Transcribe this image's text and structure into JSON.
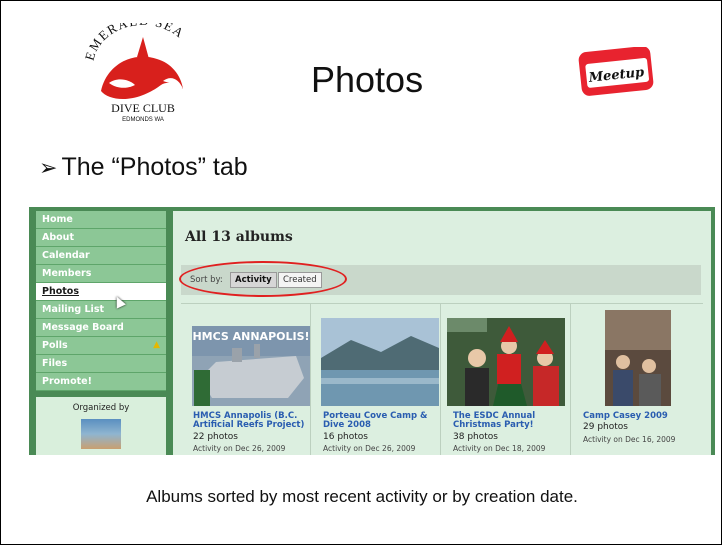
{
  "slide": {
    "title": "Photos",
    "bullet": "The “Photos” tab",
    "caption": "Albums sorted by most recent activity or by creation date.",
    "logo_left_text": [
      "EMERALD SEA",
      "DIVE CLUB",
      "EDMONDS WA"
    ],
    "logo_right_text": "Meetup"
  },
  "sidebar": {
    "items": [
      {
        "label": "Home"
      },
      {
        "label": "About"
      },
      {
        "label": "Calendar"
      },
      {
        "label": "Members"
      },
      {
        "label": "Photos",
        "active": true
      },
      {
        "label": "Mailing List"
      },
      {
        "label": "Message Board"
      },
      {
        "label": "Polls",
        "icon": "warning-icon"
      },
      {
        "label": "Files"
      },
      {
        "label": "Promote!"
      }
    ],
    "organized_by": "Organized by"
  },
  "main": {
    "title": "All 13 albums",
    "sort_label": "Sort by:",
    "sort_options": [
      "Activity",
      "Created"
    ],
    "sort_selected": "Activity"
  },
  "albums": [
    {
      "title": "HMCS Annapolis (B.C. Artificial Reefs Project)",
      "count": "22 photos",
      "activity": "Activity on Dec 26, 2009",
      "thumb_text": "HMCS ANNAPOLIS!"
    },
    {
      "title": "Porteau Cove Camp & Dive 2008",
      "count": "16 photos",
      "activity": "Activity on Dec 26, 2009"
    },
    {
      "title": "The ESDC Annual Christmas Party!",
      "count": "38 photos",
      "activity": "Activity on Dec 18, 2009"
    },
    {
      "title": "Camp Casey 2009",
      "count": "29 photos",
      "activity": "Activity on Dec 16, 2009"
    }
  ],
  "colors": {
    "accent_red": "#e02020",
    "link_blue": "#2a5db0",
    "nav_green": "#8cc796",
    "frame_green": "#4a8a55"
  }
}
